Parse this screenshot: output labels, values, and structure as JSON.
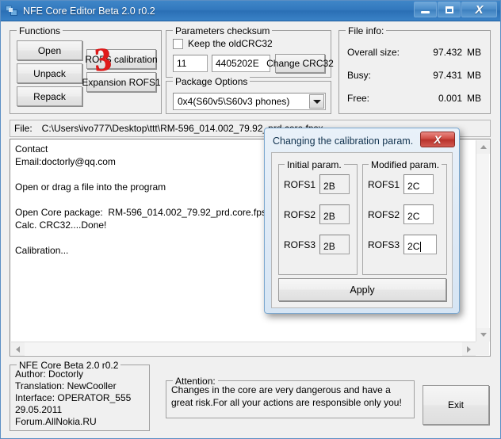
{
  "window": {
    "title": "NFE Core Editor Beta 2.0 r0.2",
    "icon": "app-icon",
    "buttons": {
      "minimize": "minimize-icon",
      "maximize": "maximize-icon",
      "close": "X"
    }
  },
  "annotation": {
    "step_number": "3",
    "color": "#e01b1b"
  },
  "functions": {
    "title": "Functions",
    "open": "Open",
    "unpack": "Unpack",
    "repack": "Repack",
    "rofs_calibration": "ROFS calibration",
    "expansion_rofs1": "Expansion ROFS1"
  },
  "checksum": {
    "title": "Parameters checksum",
    "keep_old_label": "Keep the oldCRC32",
    "keep_old_checked": false,
    "field1": "11",
    "field2": "4405202E",
    "change_button": "Change CRC32"
  },
  "package": {
    "title": "Package Options",
    "selected": "0x4(S60v5\\S60v3 phones)"
  },
  "fileinfo": {
    "title": "File info:",
    "rows": [
      {
        "label": "Overall size:",
        "value": "97.432",
        "unit": "MB"
      },
      {
        "label": "Busy:",
        "value": "97.431",
        "unit": "MB"
      },
      {
        "label": "Free:",
        "value": "0.001",
        "unit": "MB"
      }
    ]
  },
  "file": {
    "label": "File:",
    "path": "C:\\Users\\ivo777\\Desktop\\ttt\\RM-596_014.002_79.92_prd.core.fpsx"
  },
  "log": {
    "text": "Contact\nEmail:doctorly@qq.com\n\nOpen or drag a file into the program\n\nOpen Core package:  RM-596_014.002_79.92_prd.core.fpsx...\nCalc. CRC32....Done!\n\nCalibration..."
  },
  "about": {
    "title": "NFE Core Beta 2.0 r0.2",
    "lines": [
      "Author: Doctorly",
      "Translation: NewCooller",
      "Interface: OPERATOR_555",
      "29.05.2011",
      "Forum.AllNokia.RU"
    ]
  },
  "attention": {
    "title": "Attention:",
    "line1": "Changes in the core are very dangerous and have a",
    "line2": "great risk.For all your actions are responsible only you!"
  },
  "exit_button": "Exit",
  "dialog": {
    "title": "Changing the calibration param.",
    "close_label": "X",
    "initial": {
      "title": "Initial param.",
      "rows": [
        {
          "label": "ROFS1",
          "value": "2B"
        },
        {
          "label": "ROFS2",
          "value": "2B"
        },
        {
          "label": "ROFS3",
          "value": "2B"
        }
      ]
    },
    "modified": {
      "title": "Modified param.",
      "rows": [
        {
          "label": "ROFS1",
          "value": "2C"
        },
        {
          "label": "ROFS2",
          "value": "2C"
        },
        {
          "label": "ROFS3",
          "value": "2C"
        }
      ]
    },
    "apply_label": "Apply"
  }
}
